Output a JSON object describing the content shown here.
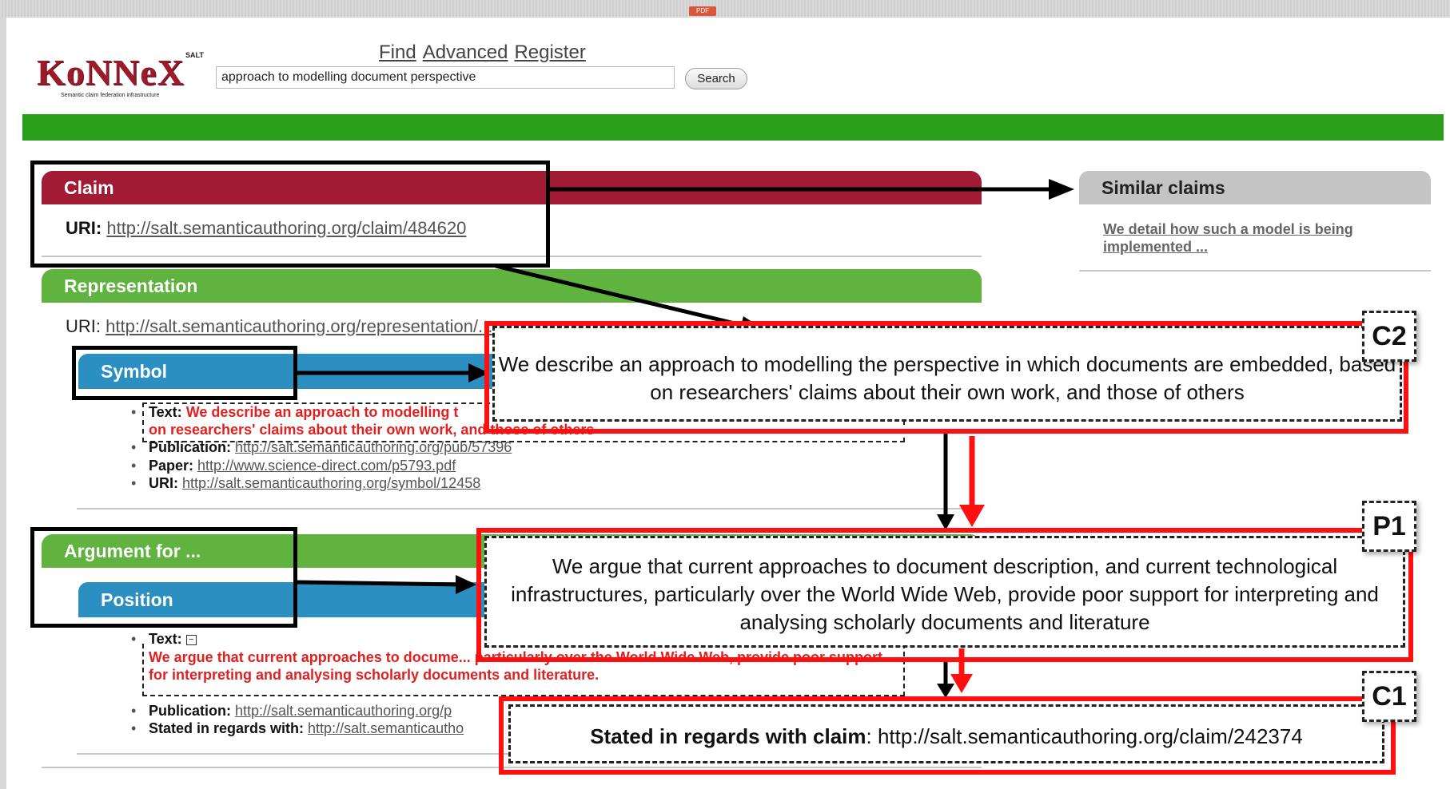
{
  "browser": {
    "pdf_badge": "PDF"
  },
  "logo": {
    "name": "KoNNeX",
    "superscript": "SALT",
    "tagline": "Semantic claim federation infrastructure"
  },
  "nav": {
    "links": [
      "Find",
      "Advanced",
      "Register"
    ]
  },
  "search": {
    "value": "approach to modelling document perspective",
    "button_label": "Search"
  },
  "claim": {
    "header": "Claim",
    "uri_label": "URI:",
    "uri": "http://salt.semanticauthoring.org/claim/484620"
  },
  "representation": {
    "header": "Representation",
    "uri_label": "URI:",
    "uri": "http://salt.semanticauthoring.org/representation/..."
  },
  "symbol": {
    "header": "Symbol",
    "text_label": "Text:",
    "text_line1": "We describe an approach to modelling t",
    "text_line2": "on researchers' claims about their own work, and those of others",
    "publication_label": "Publication:",
    "publication": "http://salt.semanticauthoring.org/pub/57396",
    "paper_label": "Paper:",
    "paper": "http://www.science-direct.com/p5793.pdf",
    "uri_label": "URI:",
    "uri": "http://salt.semanticauthoring.org/symbol/12458"
  },
  "argument": {
    "header": "Argument for ...",
    "position_header": "Position",
    "text_label": "Text:",
    "text_collapse_icon": "minus-box-icon",
    "text_red": "We argue that current approaches to docume... particularly over the World Wide Web, provide poor support for interpreting and analysing scholarly documents and literature.",
    "publication_label": "Publication:",
    "publication": "http://salt.semanticauthoring.org/p",
    "stated_label": "Stated in regards with:",
    "stated": "http://salt.semanticautho"
  },
  "similar": {
    "header": "Similar claims",
    "link": "We detail how such a model is being implemented ..."
  },
  "callouts": {
    "c2_text": "We describe an approach to modelling the perspective in which documents are embedded, based on researchers' claims about their own work, and those of others",
    "c2_tag": "C2",
    "p1_text": "We argue that current approaches to document description, and current technological infrastructures, particularly over the World Wide Web, provide poor support for interpreting and analysing scholarly documents and literature",
    "p1_tag": "P1",
    "c1_label": "Stated in regards with claim",
    "c1_uri": "http://salt.semanticauthoring.org/claim/242374",
    "c1_tag": "C1"
  },
  "colors": {
    "claim_header": "#a01b33",
    "green_header": "#5fb33e",
    "blue_header": "#2b8fc2",
    "green_bar": "#2aa01a",
    "highlight_red": "#ff1010",
    "text_red": "#e12020"
  }
}
